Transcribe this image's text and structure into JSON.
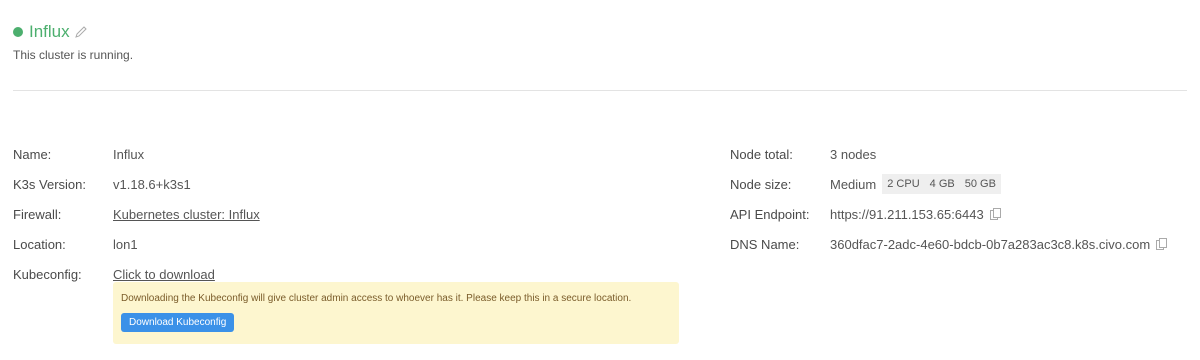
{
  "colors": {
    "running": "#4caf6e",
    "button": "#3b91e8",
    "warning_bg": "#fdf6cf"
  },
  "header": {
    "title": "Influx",
    "status_text": "This cluster is running.",
    "edit_icon": "pencil-icon"
  },
  "details_left": [
    {
      "label": "Name:",
      "value": "Influx"
    },
    {
      "label": "K3s Version:",
      "value": "v1.18.6+k3s1"
    },
    {
      "label": "Firewall:",
      "value": "Kubernetes cluster: Influx"
    },
    {
      "label": "Location:",
      "value": "lon1"
    },
    {
      "label": "Kubeconfig:",
      "value": "Click to download"
    }
  ],
  "details_right": {
    "node_total": {
      "label": "Node total:",
      "value": "3 nodes"
    },
    "node_size": {
      "label": "Node size:",
      "value": "Medium",
      "chips": [
        "2 CPU",
        "4 GB",
        "50 GB"
      ]
    },
    "api_endpoint": {
      "label": "API Endpoint:",
      "value": "https://91.211.153.65:6443",
      "icon": "copy-icon"
    },
    "dns_name": {
      "label": "DNS Name:",
      "value": "360dfac7-2adc-4e60-bdcb-0b7a283ac3c8.k8s.civo.com",
      "icon": "copy-icon"
    }
  },
  "kubeconfig_notice": {
    "text": "Downloading the Kubeconfig will give cluster admin access to whoever has it. Please keep this in a secure location.",
    "button_label": "Download Kubeconfig"
  }
}
